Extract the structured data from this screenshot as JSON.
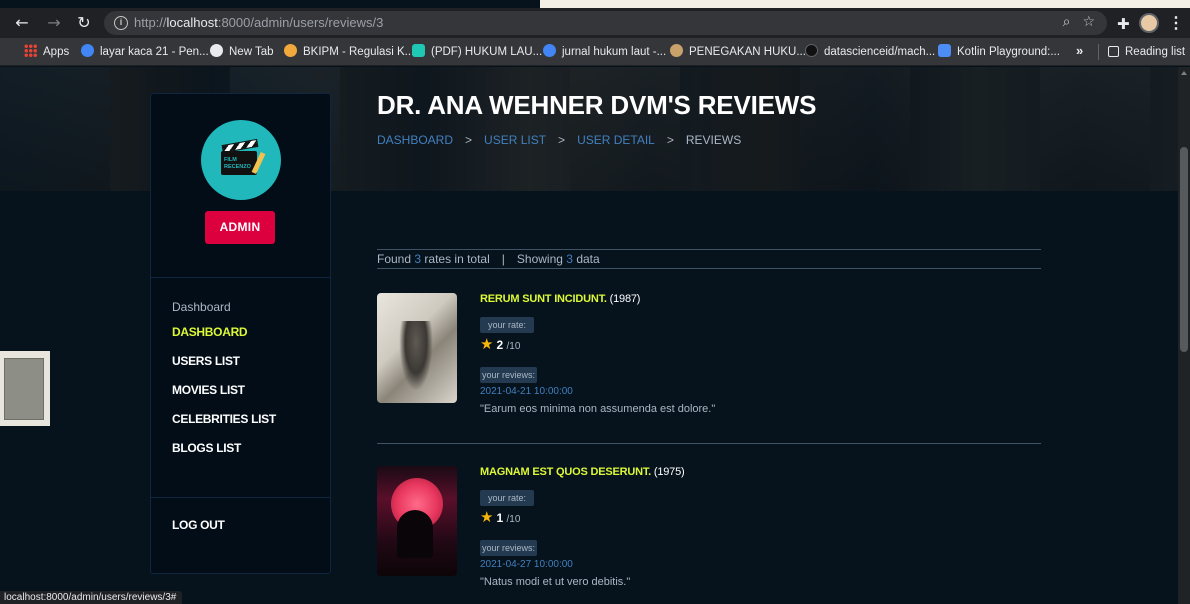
{
  "browser": {
    "url_prefix": "http://",
    "url_host": "localhost",
    "url_path": ":8000/admin/users/reviews/3",
    "bookmarks": [
      {
        "label": "Apps",
        "color": "#ea4335"
      },
      {
        "label": "layar kaca 21 - Pen...",
        "color": "#4285f4"
      },
      {
        "label": "New Tab",
        "color": "#e8eaed"
      },
      {
        "label": "BKIPM - Regulasi K...",
        "color": "#f2a93b"
      },
      {
        "label": "(PDF) HUKUM LAU...",
        "color": "#1ec8b4"
      },
      {
        "label": "jurnal hukum laut -...",
        "color": "#4285f4"
      },
      {
        "label": "PENEGAKAN HUKU...",
        "color": "#c9a26b"
      },
      {
        "label": "datascienceid/mach...",
        "color": "#202124"
      },
      {
        "label": "Kotlin Playground:...",
        "color": "#4c8df6"
      }
    ],
    "bookmarks_more": "»",
    "reading_list": "Reading list",
    "status_url": "localhost:8000/admin/users/reviews/3#"
  },
  "sidebar": {
    "logo_text_1": "FILM",
    "logo_text_2": "RECENZO",
    "admin_label": "ADMIN",
    "heading": "Dashboard",
    "links": [
      "DASHBOARD",
      "USERS LIST",
      "MOVIES LIST",
      "CELEBRITIES LIST",
      "BLOGS LIST"
    ],
    "logout": "LOG OUT"
  },
  "header": {
    "title": "DR. ANA WEHNER DVM'S REVIEWS",
    "breadcrumb": [
      "DASHBOARD",
      "USER LIST",
      "USER DETAIL",
      "REVIEWS"
    ],
    "breadcrumb_sep": ">"
  },
  "summary": {
    "found_prefix": "Found",
    "found_count": "3",
    "found_suffix": "rates in total",
    "pipe": "|",
    "showing_prefix": "Showing",
    "showing_count": "3",
    "showing_suffix": "data"
  },
  "reviews": [
    {
      "title": "RERUM SUNT INCIDUNT.",
      "year": "(1987)",
      "rate_label": "your rate:",
      "rate": "2",
      "rate_out": "/10",
      "reviews_label": "your reviews:",
      "date": "2021-04-21 10:00:00",
      "text": "\"Earum eos minima non assumenda est dolore.\""
    },
    {
      "title": "MAGNAM EST QUOS DESERUNT.",
      "year": "(1975)",
      "rate_label": "your rate:",
      "rate": "1",
      "rate_out": "/10",
      "reviews_label": "your reviews:",
      "date": "2021-04-27 10:00:00",
      "text": "\"Natus modi et ut vero debitis.\""
    }
  ],
  "colors": {
    "accent_yellow": "#dcf836",
    "admin_red": "#dd003f",
    "link_blue": "#4280bf",
    "star": "#f5b50a"
  }
}
